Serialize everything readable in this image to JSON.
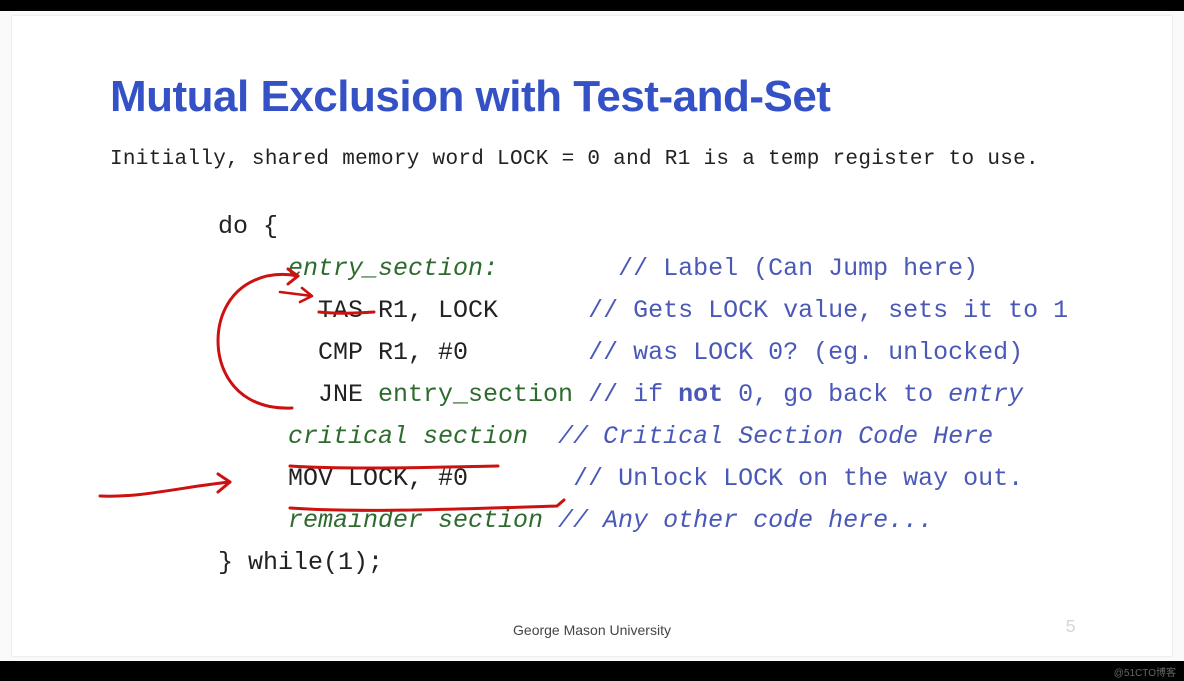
{
  "title": "Mutual Exclusion with Test-and-Set",
  "subtitle": "Initially, shared memory word LOCK = 0 and R1 is a temp register to use.",
  "code": {
    "do_open": "do {",
    "entry_label": "entry_section:",
    "entry_comment": "// Label (Can Jump here)",
    "tas": "TAS R1, LOCK",
    "tas_comment": "// Gets LOCK value, sets it to 1",
    "cmp": "CMP R1, #0",
    "cmp_comment": "// was LOCK 0? (eg. unlocked)",
    "jne": "JNE ",
    "jne_ref": "entry_section",
    "jne_comment_pre": " // if ",
    "jne_not": "not",
    "jne_comment_mid": " 0, go back to ",
    "jne_entry_it": "entry",
    "critical": "critical section",
    "critical_comment": "  // Critical Section Code Here",
    "mov": "MOV LOCK, #0",
    "mov_comment": "// Unlock LOCK on the way out.",
    "remainder": "remainder section",
    "remainder_comment": " // Any other code here...",
    "while_close": "} while(1);"
  },
  "footer": "George Mason University",
  "slide_number": "5",
  "watermark": "@51CTO博客"
}
